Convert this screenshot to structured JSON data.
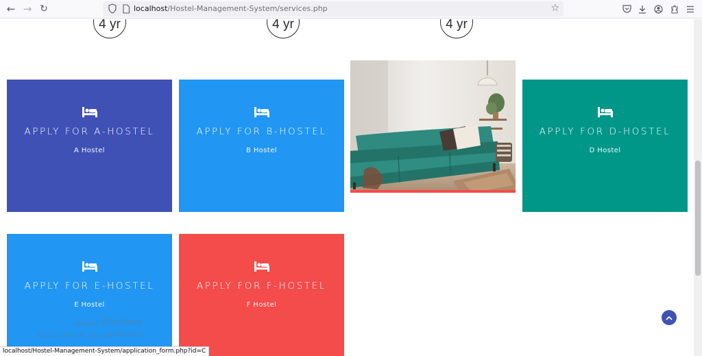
{
  "browser": {
    "url_host": "localhost",
    "url_path": "/Hostel-Management-System/services.php",
    "status_link": "localhost/Hostel-Management-System/application_form.php?id=C"
  },
  "badges": [
    "4 yr",
    "4 yr",
    "4 yr"
  ],
  "cards": [
    {
      "title": "Apply for A-Hostel",
      "subtitle": "A Hostel",
      "color": "#3f51b5"
    },
    {
      "title": "Apply for B-Hostel",
      "subtitle": "B Hostel",
      "color": "#2196f3"
    },
    {
      "title": "Apply for D-Hostel",
      "subtitle": "D Hostel",
      "color": "#009688"
    },
    {
      "title": "Apply for E-Hostel",
      "subtitle": "E Hostel",
      "color": "#2196f3"
    },
    {
      "title": "Apply for F-Hostel",
      "subtitle": "F Hostel",
      "color": "#f44b4b"
    }
  ],
  "watermark": {
    "line1": "تنشيط Windows",
    "line2": "انتقل إلى الإعدادات لتنشيط Windows."
  },
  "icons": {
    "back": "arrow-left-icon",
    "forward": "arrow-right-icon",
    "reload": "reload-icon",
    "bookmark": "star-icon",
    "card": "bed-icon",
    "scroll_top": "chevron-up-icon"
  }
}
